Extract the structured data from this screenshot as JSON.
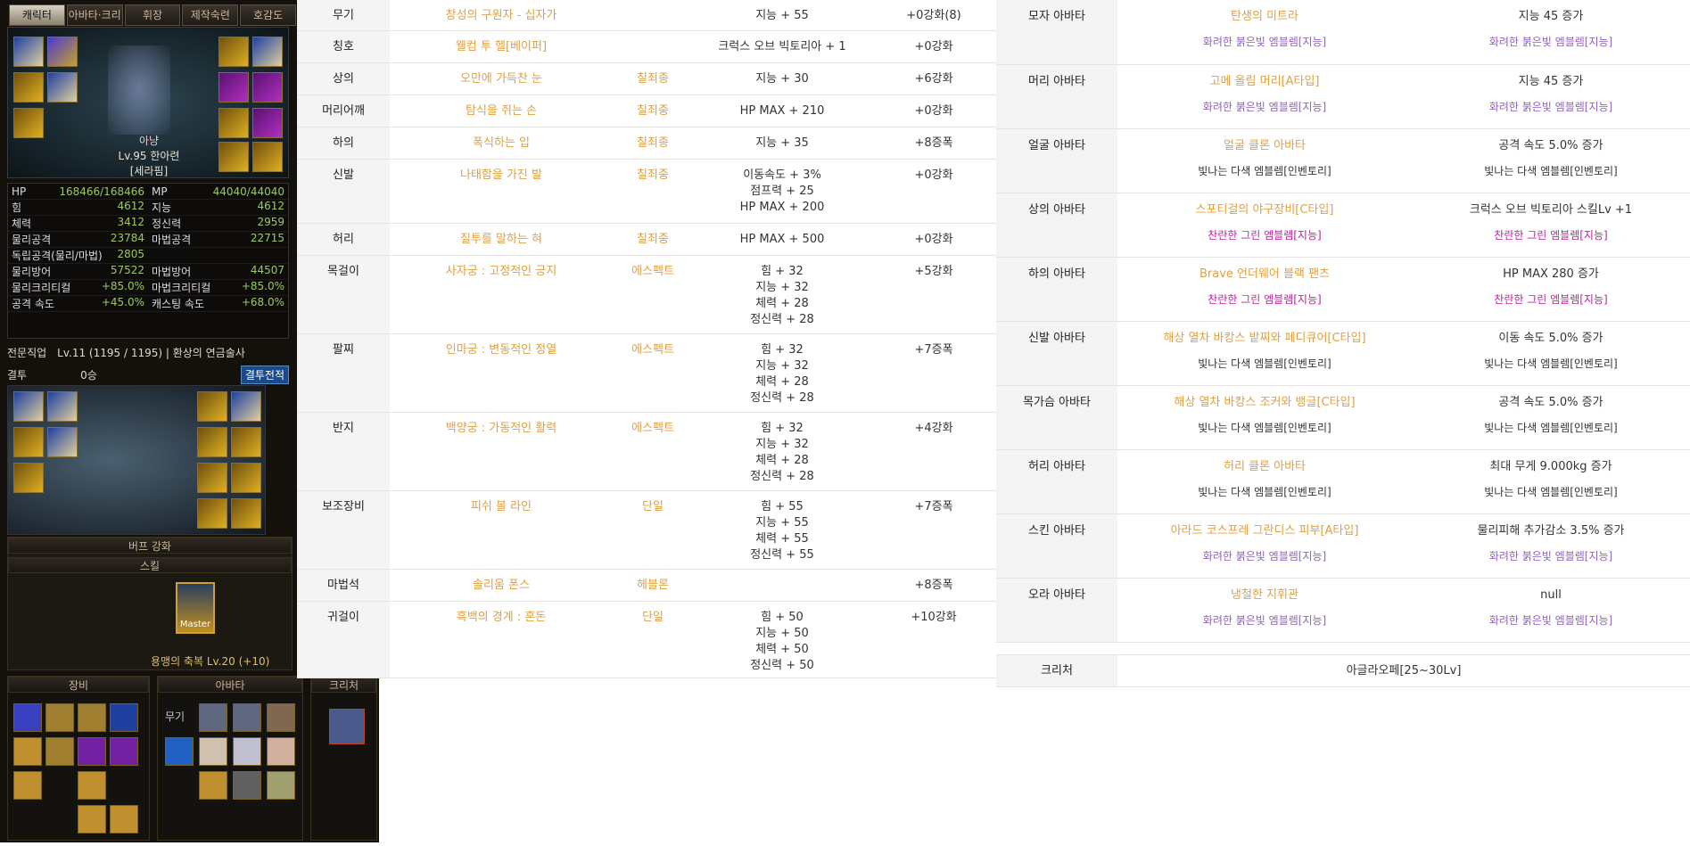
{
  "game": {
    "tabs": [
      "캐릭터",
      "아바타·크리처",
      "휘장",
      "제작숙련",
      "호감도"
    ],
    "character": {
      "class": "아냥",
      "level": "Lv.95",
      "name": "한아련",
      "guild": "[세라핌]"
    },
    "stats": [
      {
        "l": "HP",
        "v": "168466/168466",
        "l2": "MP",
        "v2": "44040/44040"
      },
      {
        "l": "힘",
        "v": "4612",
        "l2": "지능",
        "v2": "4612"
      },
      {
        "l": "체력",
        "v": "3412",
        "l2": "정신력",
        "v2": "2959"
      },
      {
        "l": "물리공격",
        "v": "23784",
        "l2": "마법공격",
        "v2": "22715"
      },
      {
        "l": "독립공격(물리/마법)",
        "v": "2805",
        "l2": "",
        "v2": ""
      },
      {
        "l": "물리방어",
        "v": "57522",
        "l2": "마법방어",
        "v2": "44507"
      },
      {
        "l": "물리크리티컬",
        "v": "+85.0%",
        "l2": "마법크리티컬",
        "v2": "+85.0%"
      },
      {
        "l": "공격 속도",
        "v": "+45.0%",
        "l2": "캐스팅 속도",
        "v2": "+68.0%"
      }
    ],
    "job": {
      "label": "전문직업",
      "value": "Lv.11 (1195 / 1195) | 환상의 연금술사",
      "duel_label": "결투",
      "duel_value": "0승",
      "duel_button": "결투전적"
    },
    "buff": {
      "title": "버프 강화",
      "skill_title": "스킬",
      "master": "Master",
      "skill_name": "용맹의 축복 Lv.20 (+10)"
    },
    "bottom": {
      "equip": "장비",
      "avatar": "아바타",
      "creature": "크리처",
      "weapon_label": "무기"
    }
  },
  "equipment": [
    {
      "slot": "무기",
      "name": "창성의 구원자 - 십자가",
      "set": "",
      "stats": [
        "지능 + 55"
      ],
      "upgrade": "+0강화(8)",
      "amp": false
    },
    {
      "slot": "칭호",
      "name": "웰컴 투 헬[베이퍼]",
      "set": "",
      "stats": [
        "크럭스 오브 빅토리아 + 1"
      ],
      "upgrade": "+0강화",
      "amp": false
    },
    {
      "slot": "상의",
      "name": "오만에 가득찬 눈",
      "set": "칠죄종",
      "stats": [
        "지능 + 30"
      ],
      "upgrade": "+6강화",
      "amp": false
    },
    {
      "slot": "머리어깨",
      "name": "탐식을 쥐는 손",
      "set": "칠죄종",
      "stats": [
        "HP MAX + 210"
      ],
      "upgrade": "+0강화",
      "amp": false
    },
    {
      "slot": "하의",
      "name": "폭식하는 입",
      "set": "칠죄종",
      "stats": [
        "지능 + 35"
      ],
      "upgrade": "+8증폭",
      "amp": true
    },
    {
      "slot": "신발",
      "name": "나태함을 가진 발",
      "set": "칠죄종",
      "stats": [
        "이동속도 + 3%",
        "점프력 + 25",
        "HP MAX + 200"
      ],
      "upgrade": "+0강화",
      "amp": false
    },
    {
      "slot": "허리",
      "name": "질투를 말하는 혀",
      "set": "칠죄종",
      "stats": [
        "HP MAX + 500"
      ],
      "upgrade": "+0강화",
      "amp": false
    },
    {
      "slot": "목걸이",
      "name": "사자궁 : 고정적인 긍지",
      "set": "에스펙트",
      "stats": [
        "힘 + 32",
        "지능 + 32",
        "체력 + 28",
        "정신력 + 28"
      ],
      "upgrade": "+5강화",
      "amp": false
    },
    {
      "slot": "팔찌",
      "name": "인마궁 : 변동적인 정열",
      "set": "에스펙트",
      "stats": [
        "힘 + 32",
        "지능 + 32",
        "체력 + 28",
        "정신력 + 28"
      ],
      "upgrade": "+7증폭",
      "amp": true
    },
    {
      "slot": "반지",
      "name": "백양궁 : 가동적인 활력",
      "set": "에스펙트",
      "stats": [
        "힘 + 32",
        "지능 + 32",
        "체력 + 28",
        "정신력 + 28"
      ],
      "upgrade": "+4강화",
      "amp": false
    },
    {
      "slot": "보조장비",
      "name": "피쉬 볼 라인",
      "set": "단일",
      "stats": [
        "힘 + 55",
        "지능 + 55",
        "체력 + 55",
        "정신력 + 55"
      ],
      "upgrade": "+7증폭",
      "amp": true
    },
    {
      "slot": "마법석",
      "name": "솔리움 폰스",
      "set": "헤블론",
      "stats": [],
      "upgrade": "+8증폭",
      "amp": true
    },
    {
      "slot": "귀걸이",
      "name": "흑백의 경계 : 혼돈",
      "set": "단일",
      "stats": [
        "힘 + 50",
        "지능 + 50",
        "체력 + 50",
        "정신력 + 50"
      ],
      "upgrade": "+10강화",
      "amp": false
    }
  ],
  "avatars": [
    {
      "slot": "모자 아바타",
      "name": "탄생의 미트라",
      "emb1": "화려한 붉은빛 엠블렘[지능]",
      "c1": "pur",
      "opt": "지능 45 증가",
      "emb2": "화려한 붉은빛 엠블렘[지능]",
      "c2": "pur"
    },
    {
      "slot": "머리 아바타",
      "name": "고메 올림 머리[A타입]",
      "emb1": "화려한 붉은빛 엠블렘[지능]",
      "c1": "pur",
      "opt": "지능 45 증가",
      "emb2": "화려한 붉은빛 엠블렘[지능]",
      "c2": "pur"
    },
    {
      "slot": "얼굴 아바타",
      "name": "얼굴 클론 아바타",
      "emb1": "빛나는 다색 엠블렘[인벤토리]",
      "c1": "gray",
      "opt": "공격 속도 5.0% 증가",
      "emb2": "빛나는 다색 엠블렘[인벤토리]",
      "c2": "gray"
    },
    {
      "slot": "상의 아바타",
      "name": "스포티걸의 야구장비[C타입]",
      "emb1": "찬란한 그린 엠블렘[지능]",
      "c1": "mag",
      "opt": "크럭스 오브 빅토리아 스킬Lv +1",
      "emb2": "찬란한 그린 엠블렘[지능]",
      "c2": "mag"
    },
    {
      "slot": "하의 아바타",
      "name": "Brave 언더웨어 블랙 팬츠",
      "emb1": "찬란한 그린 엠블렘[지능]",
      "c1": "mag",
      "opt": "HP MAX 280 증가",
      "emb2": "찬란한 그린 엠블렘[지능]",
      "c2": "mag"
    },
    {
      "slot": "신발 아바타",
      "name": "해상 열차 바캉스 밭찌와 페디큐어[C타입]",
      "emb1": "빛나는 다색 엠블렘[인벤토리]",
      "c1": "gray",
      "opt": "이동 속도 5.0% 증가",
      "emb2": "빛나는 다색 엠블렘[인벤토리]",
      "c2": "gray"
    },
    {
      "slot": "목가슴 아바타",
      "name": "해상 열차 바캉스 조커와 뱅글[C타입]",
      "emb1": "빛나는 다색 엠블렘[인벤토리]",
      "c1": "gray",
      "opt": "공격 속도 5.0% 증가",
      "emb2": "빛나는 다색 엠블렘[인벤토리]",
      "c2": "gray"
    },
    {
      "slot": "허리 아바타",
      "name": "허리 클론 아바타",
      "emb1": "빛나는 다색 엠블렘[인벤토리]",
      "c1": "gray",
      "opt": "최대 무게 9.000kg 증가",
      "emb2": "빛나는 다색 엠블렘[인벤토리]",
      "c2": "gray"
    },
    {
      "slot": "스킨 아바타",
      "name": "아라드 코스프레 그란디스 피부[A타입]",
      "emb1": "화려한 붉은빛 엠블렘[지능]",
      "c1": "pur",
      "opt": "물리피해 추가감소 3.5% 증가",
      "emb2": "화려한 붉은빛 엠블렘[지능]",
      "c2": "pur"
    },
    {
      "slot": "오라 아바타",
      "name": "냉철한 지휘관",
      "emb1": "화려한 붉은빛 엠블렘[지능]",
      "c1": "pur",
      "opt": "null",
      "emb2": "화려한 붉은빛 엠블렘[지능]",
      "c2": "pur"
    }
  ],
  "creature": {
    "slot": "크리처",
    "name": "아글라오페[25~30Lv]"
  }
}
